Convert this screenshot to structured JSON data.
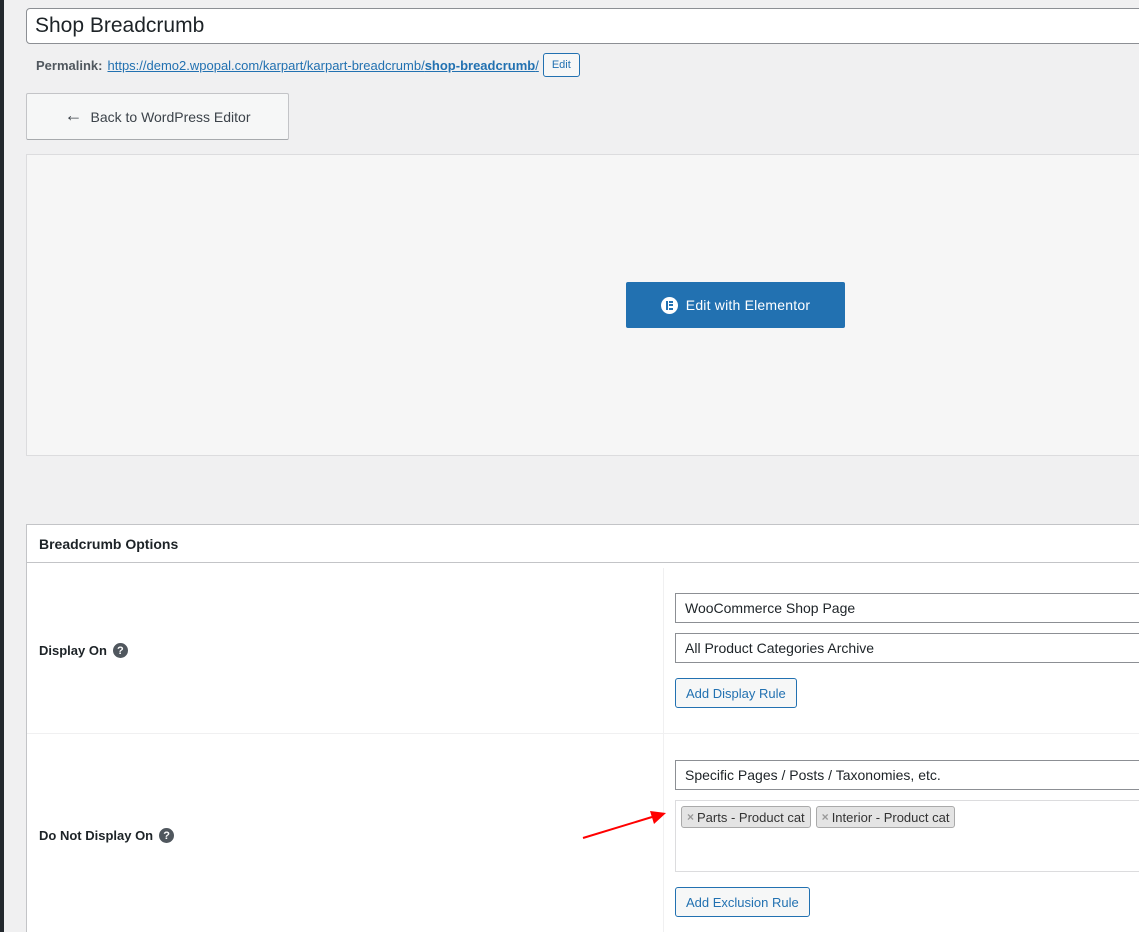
{
  "post_title": "Shop Breadcrumb",
  "permalink": {
    "label": "Permalink:",
    "url_base": "https://demo2.wpopal.com/karpart/karpart-breadcrumb/",
    "url_slug": "shop-breadcrumb",
    "url_trailing": "/",
    "edit_label": "Edit"
  },
  "back_button": {
    "label": "Back to WordPress Editor",
    "icon": "arrow-left-icon"
  },
  "elementor_button": {
    "label": "Edit with Elementor",
    "icon": "elementor-icon"
  },
  "breadcrumb_options": {
    "title": "Breadcrumb Options",
    "display_on": {
      "label": "Display On",
      "rules": [
        "WooCommerce Shop Page",
        "All Product Categories Archive"
      ],
      "add_label": "Add Display Rule"
    },
    "do_not_display_on": {
      "label": "Do Not Display On",
      "rule": "Specific Pages / Posts / Taxonomies, etc.",
      "selected": [
        {
          "label": "Parts - Product cat"
        },
        {
          "label": "Interior - Product cat"
        }
      ],
      "add_label": "Add Exclusion Rule"
    }
  },
  "colors": {
    "primary": "#2271b1",
    "annotation_arrow": "#ff0000"
  }
}
